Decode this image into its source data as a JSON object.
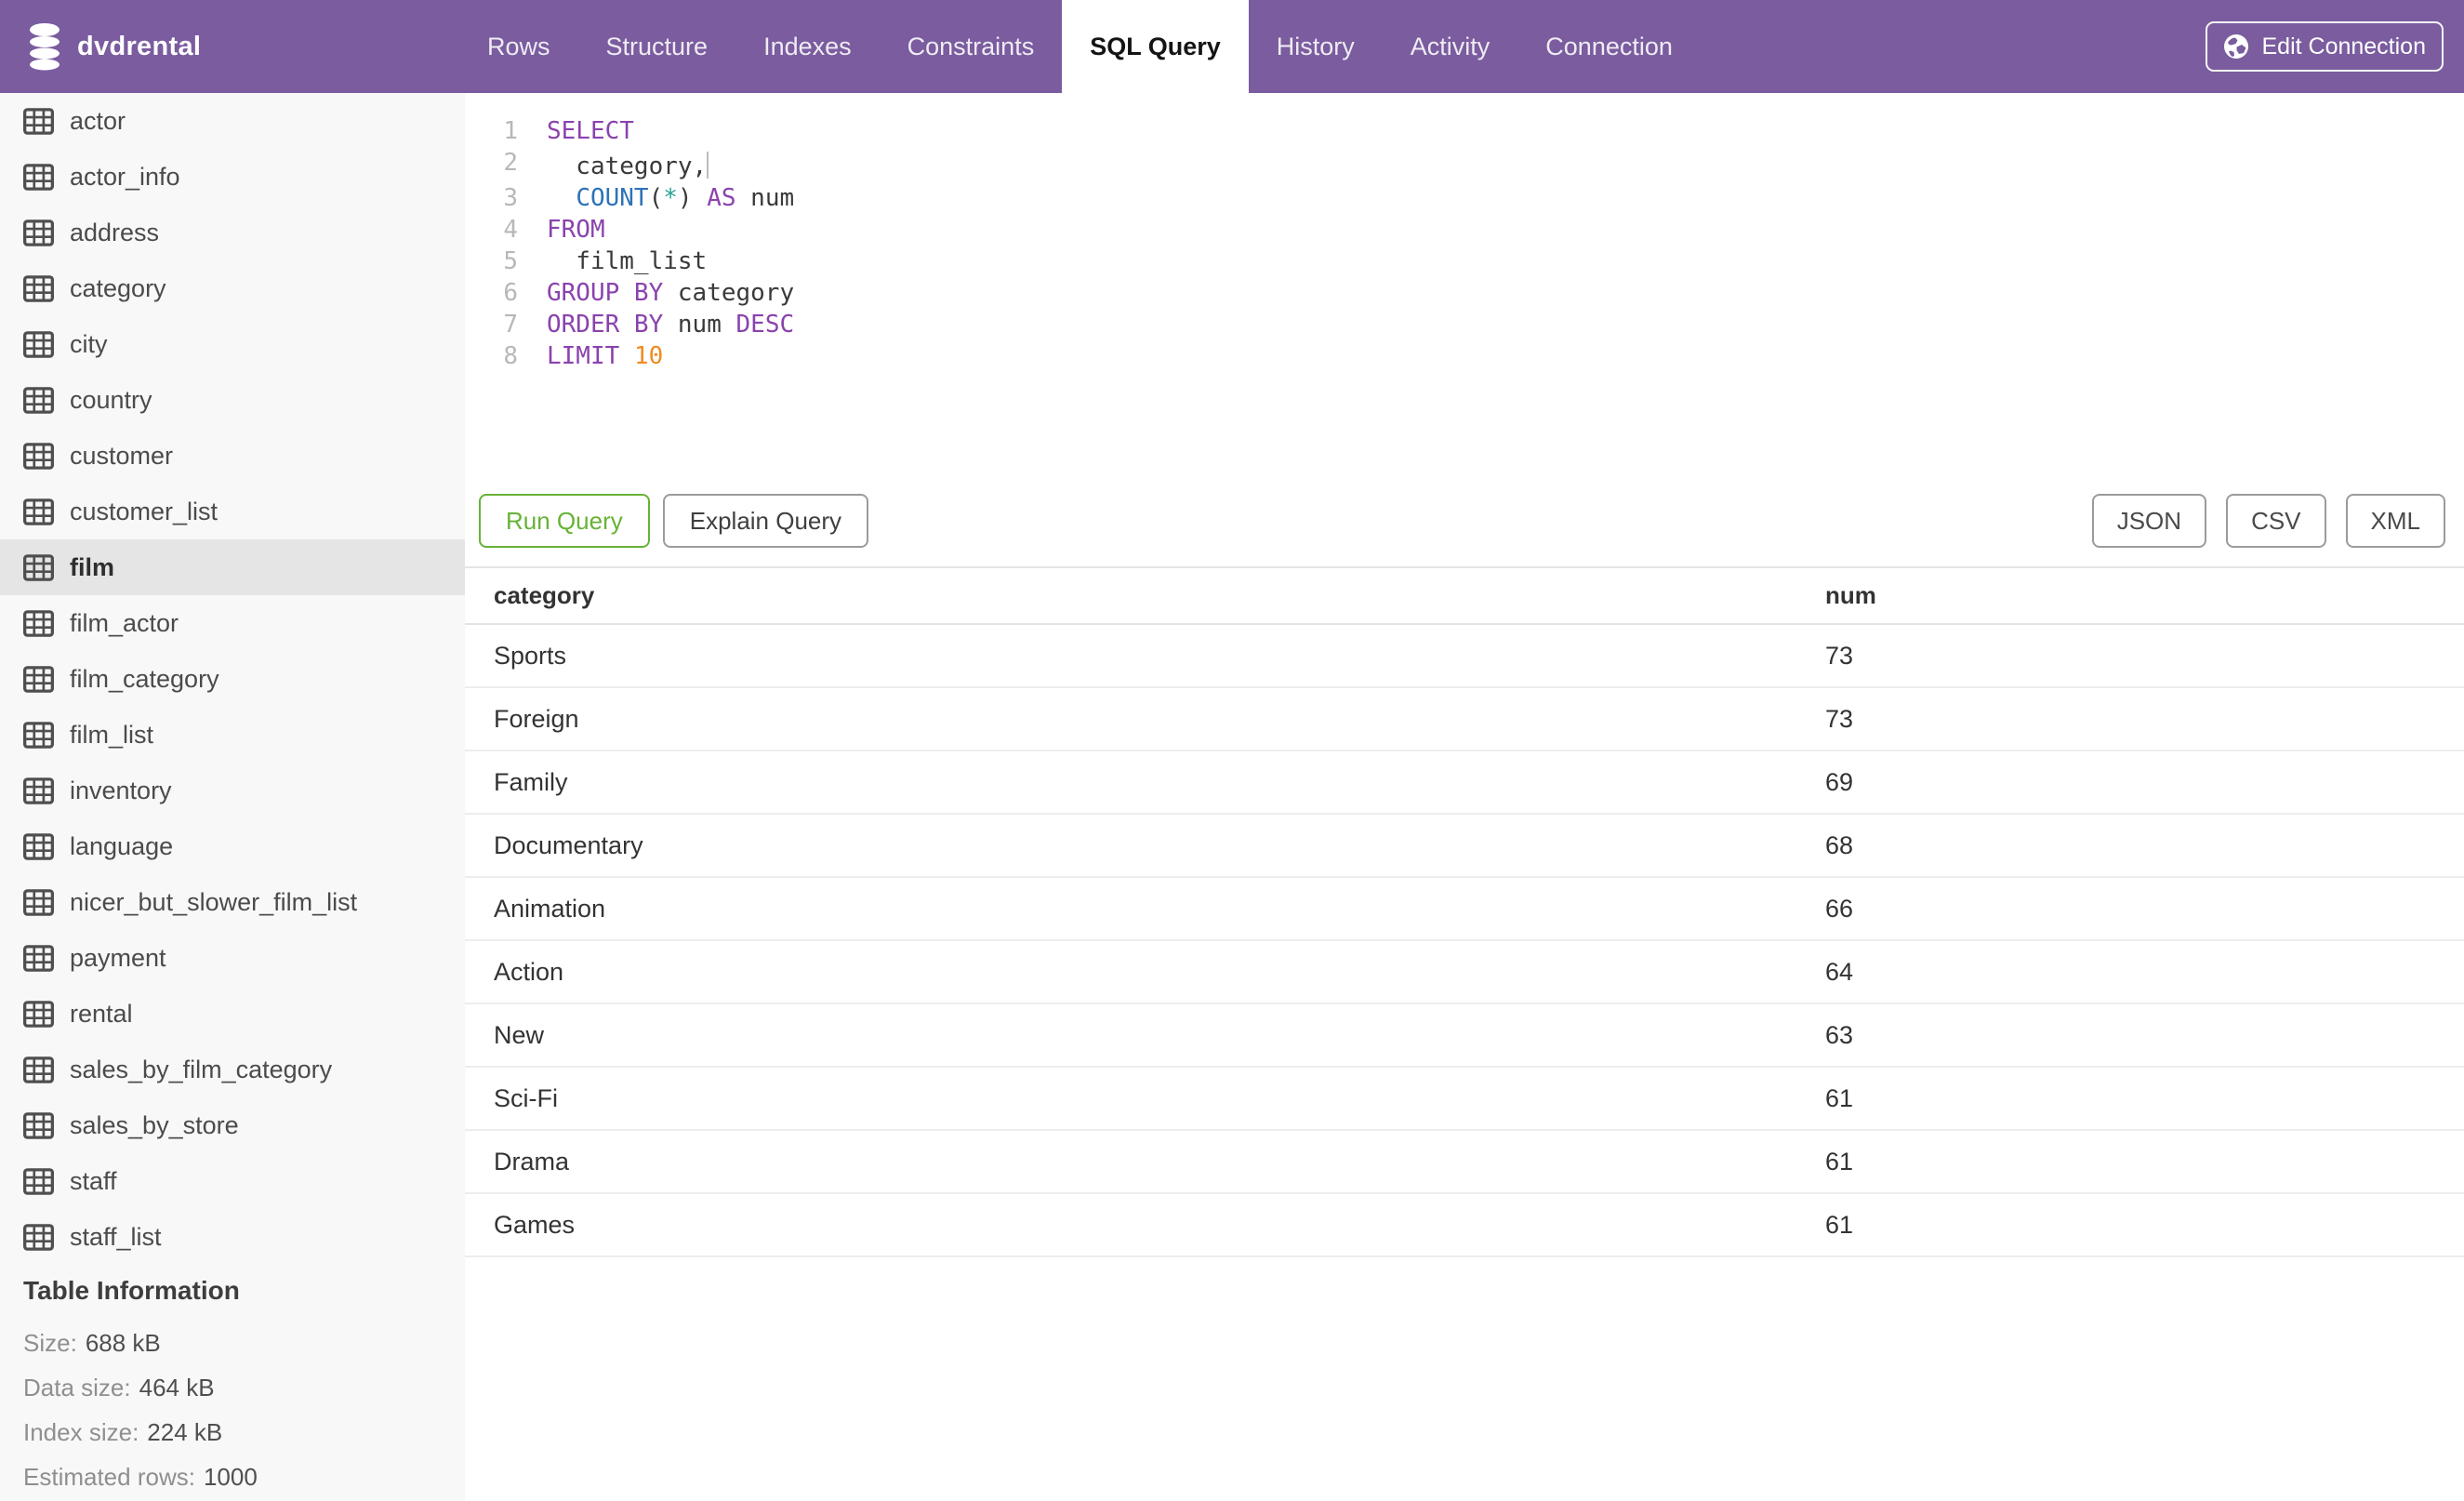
{
  "navbar": {
    "title": "dvdrental",
    "tabs": [
      {
        "label": "Rows",
        "active": false
      },
      {
        "label": "Structure",
        "active": false
      },
      {
        "label": "Indexes",
        "active": false
      },
      {
        "label": "Constraints",
        "active": false
      },
      {
        "label": "SQL Query",
        "active": true
      },
      {
        "label": "History",
        "active": false
      },
      {
        "label": "Activity",
        "active": false
      },
      {
        "label": "Connection",
        "active": false
      }
    ],
    "edit_connection_label": "Edit Connection"
  },
  "sidebar": {
    "tables": [
      {
        "label": "actor",
        "selected": false
      },
      {
        "label": "actor_info",
        "selected": false
      },
      {
        "label": "address",
        "selected": false
      },
      {
        "label": "category",
        "selected": false
      },
      {
        "label": "city",
        "selected": false
      },
      {
        "label": "country",
        "selected": false
      },
      {
        "label": "customer",
        "selected": false
      },
      {
        "label": "customer_list",
        "selected": false
      },
      {
        "label": "film",
        "selected": true
      },
      {
        "label": "film_actor",
        "selected": false
      },
      {
        "label": "film_category",
        "selected": false
      },
      {
        "label": "film_list",
        "selected": false
      },
      {
        "label": "inventory",
        "selected": false
      },
      {
        "label": "language",
        "selected": false
      },
      {
        "label": "nicer_but_slower_film_list",
        "selected": false
      },
      {
        "label": "payment",
        "selected": false
      },
      {
        "label": "rental",
        "selected": false
      },
      {
        "label": "sales_by_film_category",
        "selected": false
      },
      {
        "label": "sales_by_store",
        "selected": false
      },
      {
        "label": "staff",
        "selected": false
      },
      {
        "label": "staff_list",
        "selected": false
      }
    ],
    "info": {
      "heading": "Table Information",
      "rows": [
        {
          "label": "Size:",
          "value": "688 kB"
        },
        {
          "label": "Data size:",
          "value": "464 kB"
        },
        {
          "label": "Index size:",
          "value": "224 kB"
        },
        {
          "label": "Estimated rows:",
          "value": "1000"
        }
      ]
    }
  },
  "editor": {
    "lines": [
      {
        "number": "1",
        "tokens": [
          {
            "t": "SELECT",
            "c": "kw"
          }
        ]
      },
      {
        "number": "2",
        "tokens": [
          {
            "t": "  category,",
            "c": "txt"
          },
          {
            "caret": true
          }
        ]
      },
      {
        "number": "3",
        "tokens": [
          {
            "t": "  ",
            "c": "txt"
          },
          {
            "t": "COUNT",
            "c": "fn"
          },
          {
            "t": "(",
            "c": "txt"
          },
          {
            "t": "*",
            "c": "star"
          },
          {
            "t": ")",
            "c": "txt"
          },
          {
            "t": " ",
            "c": "txt"
          },
          {
            "t": "AS",
            "c": "kw"
          },
          {
            "t": " num",
            "c": "txt"
          }
        ]
      },
      {
        "number": "4",
        "tokens": [
          {
            "t": "FROM",
            "c": "kw"
          }
        ]
      },
      {
        "number": "5",
        "tokens": [
          {
            "t": "  film_list",
            "c": "txt"
          }
        ]
      },
      {
        "number": "6",
        "tokens": [
          {
            "t": "GROUP BY",
            "c": "kw"
          },
          {
            "t": " category",
            "c": "txt"
          }
        ]
      },
      {
        "number": "7",
        "tokens": [
          {
            "t": "ORDER BY",
            "c": "kw"
          },
          {
            "t": " num ",
            "c": "txt"
          },
          {
            "t": "DESC",
            "c": "kw"
          }
        ]
      },
      {
        "number": "8",
        "tokens": [
          {
            "t": "LIMIT",
            "c": "kw"
          },
          {
            "t": " ",
            "c": "txt"
          },
          {
            "t": "10",
            "c": "num"
          }
        ]
      }
    ]
  },
  "toolbar": {
    "run_label": "Run Query",
    "explain_label": "Explain Query",
    "export_buttons": [
      "JSON",
      "CSV",
      "XML"
    ]
  },
  "results": {
    "columns": [
      "category",
      "num"
    ],
    "rows": [
      {
        "category": "Sports",
        "num": "73"
      },
      {
        "category": "Foreign",
        "num": "73"
      },
      {
        "category": "Family",
        "num": "69"
      },
      {
        "category": "Documentary",
        "num": "68"
      },
      {
        "category": "Animation",
        "num": "66"
      },
      {
        "category": "Action",
        "num": "64"
      },
      {
        "category": "New",
        "num": "63"
      },
      {
        "category": "Sci-Fi",
        "num": "61"
      },
      {
        "category": "Drama",
        "num": "61"
      },
      {
        "category": "Games",
        "num": "61"
      }
    ]
  },
  "colors": {
    "navbar_purple": "#7a5c9f",
    "run_green": "#67b236",
    "selected_row_gray": "#e5e5e5",
    "code_keyword": "#8a42ae",
    "code_function": "#2e72b8",
    "code_star": "#2aa198",
    "code_number": "#f28b1f"
  }
}
